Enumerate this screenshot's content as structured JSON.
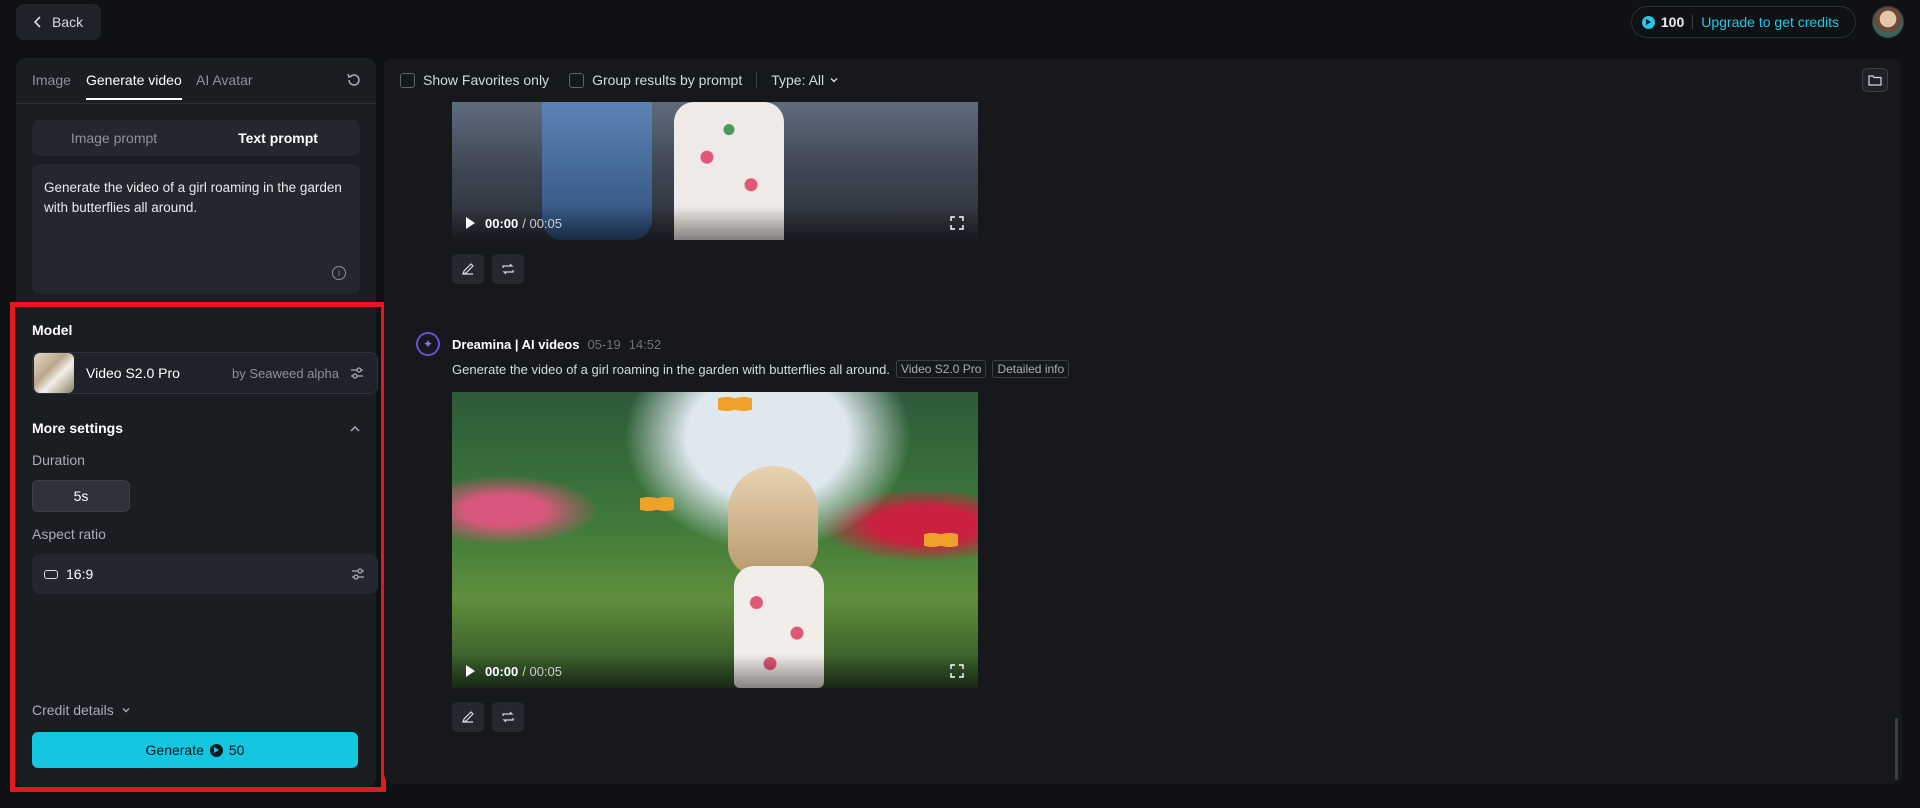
{
  "topbar": {
    "back_label": "Back",
    "credits": "100",
    "upgrade_label": "Upgrade to get credits"
  },
  "left": {
    "tabs": [
      {
        "label": "Image"
      },
      {
        "label": "Generate video"
      },
      {
        "label": "AI Avatar"
      }
    ],
    "prompt_modes": [
      {
        "label": "Image prompt"
      },
      {
        "label": "Text prompt"
      }
    ],
    "prompt_text": "Generate the video of a girl roaming in the garden with butterflies all around.",
    "model_section": "Model",
    "model_name": "Video S2.0 Pro",
    "model_by": "by Seaweed alpha",
    "more_settings": "More settings",
    "duration_label": "Duration",
    "duration_value": "5s",
    "aspect_label": "Aspect ratio",
    "aspect_value": "16:9",
    "credit_details": "Credit details",
    "generate_label": "Generate",
    "generate_cost": "50"
  },
  "filters": {
    "favorites": "Show Favorites only",
    "group": "Group results by prompt",
    "type": "Type: All"
  },
  "results": [
    {
      "time_current": "00:00",
      "time_total": "/ 00:05"
    },
    {
      "author": "Dreamina | AI videos",
      "date": "05-19",
      "time": "14:52",
      "prompt": "Generate the video of a girl roaming in the garden with butterflies all around.",
      "tags": [
        "Video S2.0 Pro",
        "Detailed info"
      ],
      "time_current": "00:00",
      "time_total": "/ 00:05"
    }
  ],
  "colors": {
    "accent": "#15c6e0",
    "highlight": "#e2191e",
    "brand": "#6d4fd6"
  }
}
